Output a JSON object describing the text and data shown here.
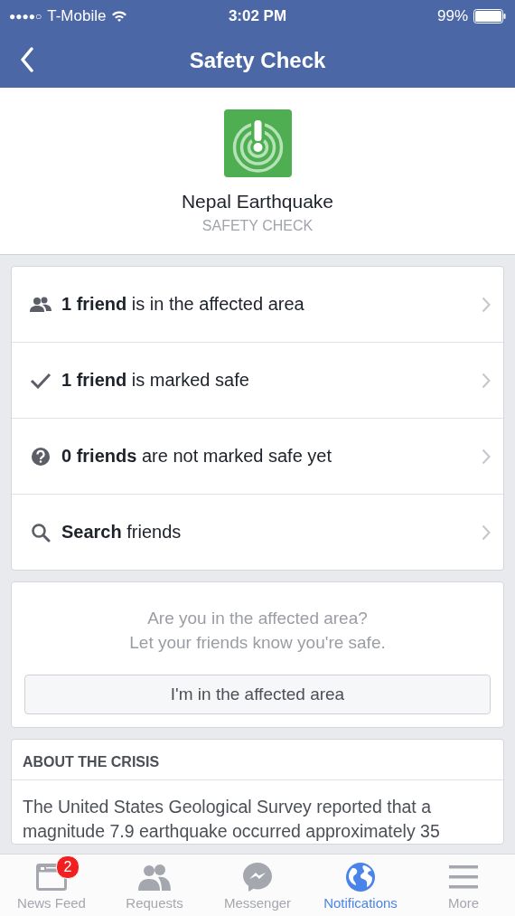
{
  "status_bar": {
    "signal_dots": "●●●●○",
    "carrier": "T-Mobile",
    "time": "3:02 PM",
    "battery": "99%"
  },
  "nav": {
    "title": "Safety Check"
  },
  "header": {
    "title": "Nepal Earthquake",
    "subtitle": "SAFETY CHECK"
  },
  "rows": [
    {
      "kind": "people",
      "text": "**1 friend** is in the affected area"
    },
    {
      "kind": "check",
      "text": "**1 friend** is marked safe"
    },
    {
      "kind": "question",
      "text": "**0 friends** are not marked safe yet"
    },
    {
      "kind": "search",
      "text": "**Search** friends"
    }
  ],
  "prompt": {
    "lines": [
      "Are you in the affected area?",
      "Let your friends know you're safe."
    ],
    "button": "I'm in the affected area"
  },
  "about": {
    "heading": "ABOUT THE CRISIS",
    "text": "The United States Geological Survey reported that a magnitude 7.9 earthquake occurred approximately 35"
  },
  "tabs": [
    {
      "kind": "feed",
      "label": "News Feed",
      "selected": false,
      "badge": "2"
    },
    {
      "kind": "requests",
      "label": "Requests",
      "selected": false
    },
    {
      "kind": "messenger",
      "label": "Messenger",
      "selected": false
    },
    {
      "kind": "globe",
      "label": "Notifications",
      "selected": true
    },
    {
      "kind": "menu",
      "label": "More",
      "selected": false
    }
  ]
}
